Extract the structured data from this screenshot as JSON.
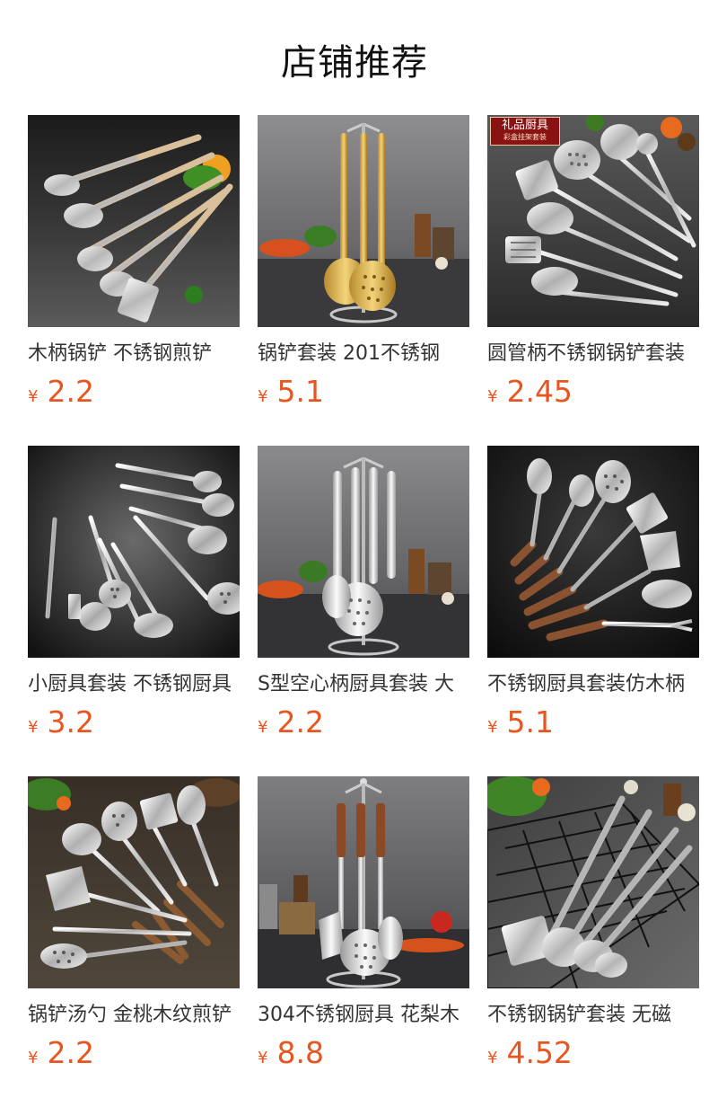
{
  "header": {
    "title": "店铺推荐"
  },
  "colors": {
    "price": "#e8551f",
    "badge_bg": "#8a1212"
  },
  "products": [
    {
      "title": "木柄锅铲 不锈钢煎铲",
      "currency": "¥",
      "price": "2.2",
      "image": "wooden-handle-utensils"
    },
    {
      "title": "锅铲套装 201不锈钢",
      "currency": "¥",
      "price": "5.1",
      "image": "gold-utensil-rack"
    },
    {
      "title": "圆管柄不锈钢锅铲套装",
      "currency": "¥",
      "price": "2.45",
      "image": "round-tube-utensils",
      "badge": {
        "line1": "礼品厨具",
        "line2": "彩盒挂架套装"
      }
    },
    {
      "title": "小厨具套装 不锈钢厨具",
      "currency": "¥",
      "price": "3.2",
      "image": "small-utensil-set"
    },
    {
      "title": "S型空心柄厨具套装 大",
      "currency": "¥",
      "price": "2.2",
      "image": "s-hollow-handle-rack"
    },
    {
      "title": "不锈钢厨具套装仿木柄",
      "currency": "¥",
      "price": "5.1",
      "image": "imitation-wood-utensils"
    },
    {
      "title": "锅铲汤勺 金桃木纹煎铲",
      "currency": "¥",
      "price": "2.2",
      "image": "walnut-grain-utensils"
    },
    {
      "title": "304不锈钢厨具 花梨木",
      "currency": "¥",
      "price": "8.8",
      "image": "rosewood-utensil-rack"
    },
    {
      "title": "不锈钢锅铲套装 无磁",
      "currency": "¥",
      "price": "4.52",
      "image": "utensils-in-basket"
    }
  ]
}
